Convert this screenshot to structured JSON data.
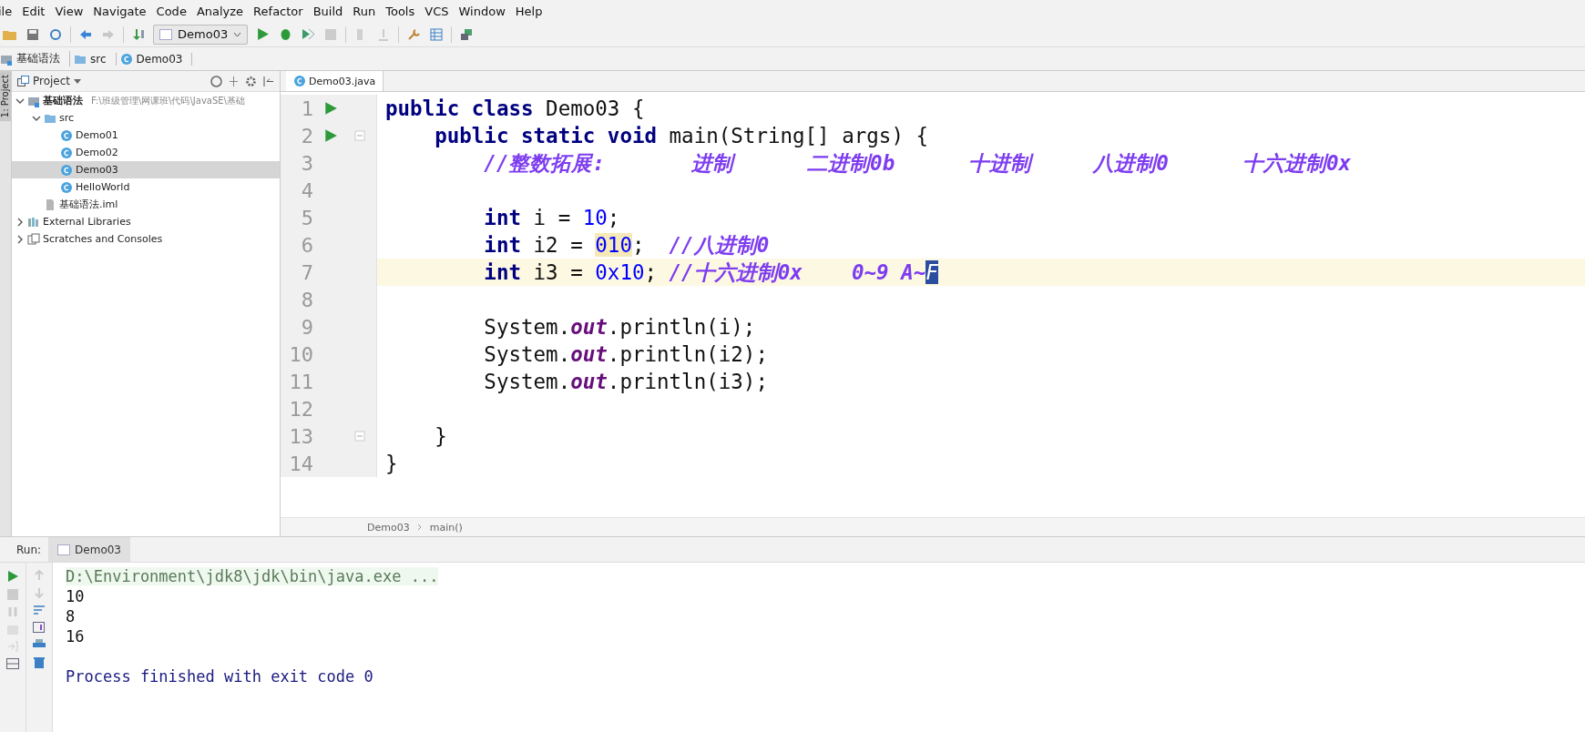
{
  "menu": [
    "ile",
    "Edit",
    "View",
    "Navigate",
    "Code",
    "Analyze",
    "Refactor",
    "Build",
    "Run",
    "Tools",
    "VCS",
    "Window",
    "Help"
  ],
  "toolbar": {
    "run_config": "Demo03"
  },
  "breadcrumb": [
    {
      "label": "基础语法",
      "kind": "module"
    },
    {
      "label": "src",
      "kind": "folder"
    },
    {
      "label": "Demo03",
      "kind": "class"
    }
  ],
  "side_stripe": {
    "label": "1: Project"
  },
  "project": {
    "title": "Project",
    "tree": [
      {
        "label": "基础语法",
        "path": "F:\\班级管理\\网课班\\代码\\JavaSE\\基础",
        "kind": "module",
        "expanded": true,
        "selected": false,
        "children": [
          {
            "label": "src",
            "kind": "folder",
            "expanded": true,
            "selected": false,
            "children": [
              {
                "label": "Demo01",
                "kind": "class",
                "selected": false
              },
              {
                "label": "Demo02",
                "kind": "class",
                "selected": false
              },
              {
                "label": "Demo03",
                "kind": "class",
                "selected": true
              },
              {
                "label": "HelloWorld",
                "kind": "class",
                "selected": false
              }
            ]
          },
          {
            "label": "基础语法.iml",
            "kind": "file",
            "selected": false
          }
        ]
      },
      {
        "label": "External Libraries",
        "kind": "library",
        "expanded": false,
        "selected": false
      },
      {
        "label": "Scratches and Consoles",
        "kind": "scratches",
        "expanded": false,
        "selected": false
      }
    ]
  },
  "editor": {
    "tab": {
      "label": "Demo03.java",
      "selected": true
    },
    "lines": [
      {
        "number": "1",
        "run": true,
        "fold": false,
        "current": false,
        "tokens": [
          {
            "kind": "keyword",
            "text": "public class "
          },
          {
            "kind": "plain",
            "text": "Demo03 {"
          }
        ]
      },
      {
        "number": "2",
        "run": true,
        "fold": true,
        "current": false,
        "tokens": [
          {
            "kind": "keyword",
            "text": "    public static void "
          },
          {
            "kind": "plain",
            "text": "main(String[] args) {"
          }
        ]
      },
      {
        "number": "3",
        "run": false,
        "fold": false,
        "current": false,
        "tokens": [
          {
            "kind": "comment",
            "text": "        //整数拓展:       进制      二进制0b      十进制     八进制0      十六进制0x"
          }
        ]
      },
      {
        "number": "4",
        "run": false,
        "fold": false,
        "current": false
      },
      {
        "number": "5",
        "run": false,
        "fold": false,
        "current": false,
        "tokens": [
          {
            "kind": "keyword",
            "text": "        int "
          },
          {
            "kind": "plain",
            "text": "i = "
          },
          {
            "kind": "number",
            "text": "10"
          },
          {
            "kind": "plain",
            "text": ";"
          }
        ]
      },
      {
        "number": "6",
        "run": false,
        "fold": false,
        "current": false,
        "tokens": [
          {
            "kind": "keyword",
            "text": "        int "
          },
          {
            "kind": "plain",
            "text": "i2 = "
          },
          {
            "kind": "number-highlight",
            "text": "010"
          },
          {
            "kind": "plain",
            "text": ";  "
          },
          {
            "kind": "comment",
            "text": "//八进制0"
          }
        ]
      },
      {
        "number": "7",
        "run": false,
        "fold": false,
        "current": true,
        "tokens": [
          {
            "kind": "keyword",
            "text": "        int "
          },
          {
            "kind": "plain",
            "text": "i3 = "
          },
          {
            "kind": "number",
            "text": "0x10"
          },
          {
            "kind": "plain",
            "text": "; "
          },
          {
            "kind": "comment",
            "text": "//十六进制0x    0~9 A~"
          },
          {
            "kind": "selection",
            "text": "F"
          }
        ]
      },
      {
        "number": "8",
        "run": false,
        "fold": false,
        "current": false
      },
      {
        "number": "9",
        "run": false,
        "fold": false,
        "current": false,
        "tokens": [
          {
            "kind": "plain",
            "text": "        System."
          },
          {
            "kind": "static",
            "text": "out"
          },
          {
            "kind": "plain",
            "text": ".println(i);"
          }
        ]
      },
      {
        "number": "10",
        "run": false,
        "fold": false,
        "current": false,
        "tokens": [
          {
            "kind": "plain",
            "text": "        System."
          },
          {
            "kind": "static",
            "text": "out"
          },
          {
            "kind": "plain",
            "text": ".println(i2);"
          }
        ]
      },
      {
        "number": "11",
        "run": false,
        "fold": false,
        "current": false,
        "tokens": [
          {
            "kind": "plain",
            "text": "        System."
          },
          {
            "kind": "static",
            "text": "out"
          },
          {
            "kind": "plain",
            "text": ".println(i3);"
          }
        ]
      },
      {
        "number": "12",
        "run": false,
        "fold": false,
        "current": false
      },
      {
        "number": "13",
        "run": false,
        "fold": true,
        "current": false,
        "tokens": [
          {
            "kind": "plain",
            "text": "    }"
          }
        ]
      },
      {
        "number": "14",
        "run": false,
        "fold": false,
        "current": false,
        "tokens": [
          {
            "kind": "plain",
            "text": "}"
          }
        ]
      }
    ],
    "breadcrumb": [
      "Demo03",
      "main()"
    ]
  },
  "run_panel": {
    "label": "Run:",
    "tab": "Demo03",
    "console": [
      {
        "kind": "command",
        "text": "D:\\Environment\\jdk8\\jdk\\bin\\java.exe ..."
      },
      {
        "kind": "output",
        "text": "10"
      },
      {
        "kind": "output",
        "text": "8"
      },
      {
        "kind": "output",
        "text": "16"
      },
      {
        "kind": "exit",
        "text": "Process finished with exit code 0"
      }
    ]
  }
}
